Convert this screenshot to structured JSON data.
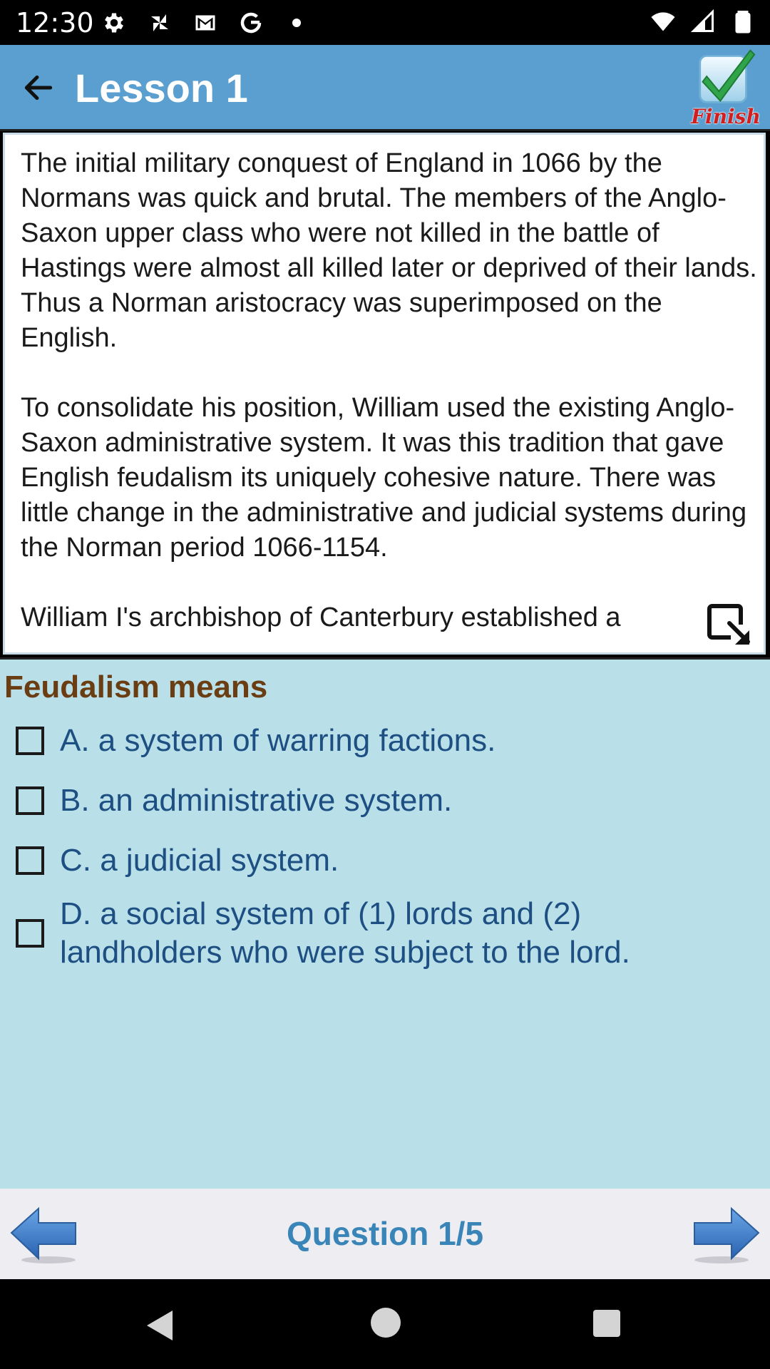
{
  "status_bar": {
    "time": "12:30",
    "icons_left": [
      "settings-icon",
      "pinwheel-icon",
      "gmail-icon",
      "google-icon",
      "dot-icon"
    ],
    "icons_right": [
      "wifi-icon",
      "signal-icon",
      "battery-icon"
    ]
  },
  "app_bar": {
    "title": "Lesson 1",
    "finish_label": "Finish"
  },
  "passage": {
    "paragraphs": [
      "The initial military conquest of England in 1066 by the Normans was quick and brutal. The members of the Anglo-Saxon upper class who were not killed in the battle of Hastings were almost all killed later or deprived of their lands. Thus a Norman aristocracy was superimposed on the English.",
      "To consolidate his position, William used the existing Anglo-Saxon administrative system. It was this tradition that gave English feudalism its uniquely cohesive nature. There was little change in the administrative and judicial systems during the Norman period 1066-1154.",
      "William I's archbishop of Canterbury established a"
    ]
  },
  "question": {
    "title": "Feudalism means",
    "options": [
      {
        "label": "A. a system of warring factions.",
        "checked": false
      },
      {
        "label": "B. an administrative system.",
        "checked": false
      },
      {
        "label": "C. a judicial system.",
        "checked": false
      },
      {
        "label": "D. a social system of (1) lords and (2) landholders who were subject to the lord.",
        "checked": false
      }
    ]
  },
  "bottom_nav": {
    "counter": "Question 1/5"
  },
  "colors": {
    "app_bar": "#5a9fcf",
    "question_bg": "#b9dfe8",
    "question_title": "#6a3d12",
    "option_text": "#1d4f82",
    "counter_text": "#3a85b8",
    "arrow": "#3b78c4"
  }
}
